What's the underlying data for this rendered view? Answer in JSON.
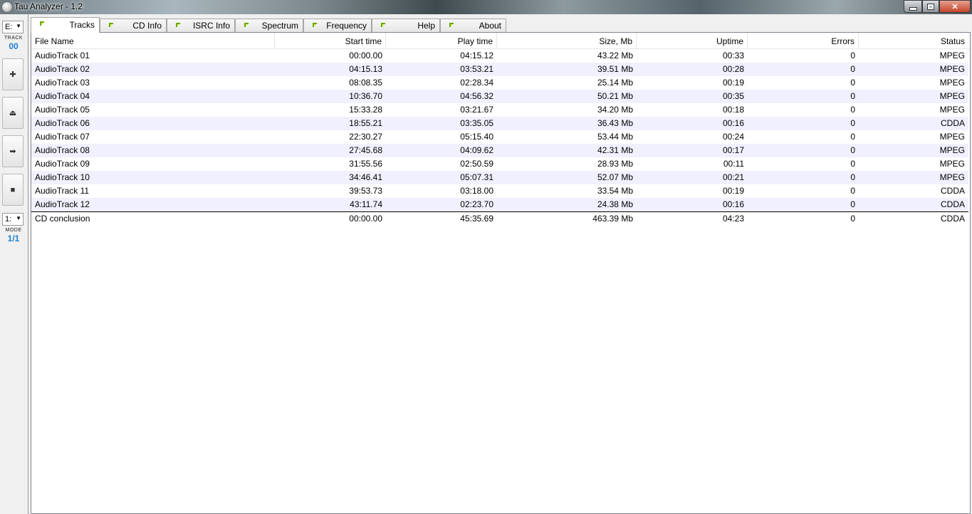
{
  "window": {
    "title": "Tau Analyzer - 1.2",
    "controls": {
      "minimize": "minimize",
      "maximize": "maximize",
      "close": "✕"
    }
  },
  "toolbar": {
    "drive": "E:",
    "track_label": "TRACK",
    "track_value": "00",
    "mode_select": "1:",
    "mode_label": "MODE",
    "mode_value": "1/1",
    "buttons": [
      {
        "icon": "plus-icon",
        "glyph": "✚"
      },
      {
        "icon": "eject-icon",
        "glyph": "⏏"
      },
      {
        "icon": "arrow-right-icon",
        "glyph": "➡"
      },
      {
        "icon": "stop-icon",
        "glyph": "■"
      }
    ]
  },
  "tabs": [
    {
      "label": "Tracks",
      "active": true
    },
    {
      "label": "CD Info"
    },
    {
      "label": "ISRC Info"
    },
    {
      "label": "Spectrum"
    },
    {
      "label": "Frequency"
    },
    {
      "label": "Help"
    },
    {
      "label": "About"
    }
  ],
  "table": {
    "columns": [
      "File Name",
      "Start time",
      "Play time",
      "Size, Mb",
      "Uptime",
      "Errors",
      "Status"
    ],
    "rows": [
      [
        "AudioTrack 01",
        "00:00.00",
        "04:15.12",
        "43.22 Mb",
        "00:33",
        "0",
        "MPEG"
      ],
      [
        "AudioTrack 02",
        "04:15.13",
        "03:53.21",
        "39.51 Mb",
        "00:28",
        "0",
        "MPEG"
      ],
      [
        "AudioTrack 03",
        "08:08.35",
        "02:28.34",
        "25.14 Mb",
        "00:19",
        "0",
        "MPEG"
      ],
      [
        "AudioTrack 04",
        "10:36.70",
        "04:56.32",
        "50.21 Mb",
        "00:35",
        "0",
        "MPEG"
      ],
      [
        "AudioTrack 05",
        "15:33.28",
        "03:21.67",
        "34.20 Mb",
        "00:18",
        "0",
        "MPEG"
      ],
      [
        "AudioTrack 06",
        "18:55.21",
        "03:35.05",
        "36.43 Mb",
        "00:16",
        "0",
        "CDDA"
      ],
      [
        "AudioTrack 07",
        "22:30.27",
        "05:15.40",
        "53.44 Mb",
        "00:24",
        "0",
        "MPEG"
      ],
      [
        "AudioTrack 08",
        "27:45.68",
        "04:09.62",
        "42.31 Mb",
        "00:17",
        "0",
        "MPEG"
      ],
      [
        "AudioTrack 09",
        "31:55.56",
        "02:50.59",
        "28.93 Mb",
        "00:11",
        "0",
        "MPEG"
      ],
      [
        "AudioTrack 10",
        "34:46.41",
        "05:07.31",
        "52.07 Mb",
        "00:21",
        "0",
        "MPEG"
      ],
      [
        "AudioTrack 11",
        "39:53.73",
        "03:18.00",
        "33.54 Mb",
        "00:19",
        "0",
        "CDDA"
      ],
      [
        "AudioTrack 12",
        "43:11.74",
        "02:23.70",
        "24.38 Mb",
        "00:16",
        "0",
        "CDDA"
      ]
    ],
    "total": [
      "CD conclusion",
      "00:00.00",
      "45:35.69",
      "463.39 Mb",
      "04:23",
      "0",
      "CDDA"
    ]
  },
  "colors": {
    "accent": "#1f7fd0",
    "alt_row": "#f0f0ff",
    "indicator": "#6aa600"
  }
}
